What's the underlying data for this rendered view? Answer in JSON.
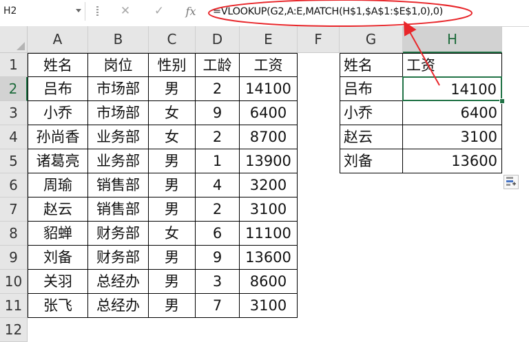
{
  "formula_bar": {
    "name_box": "H2",
    "cancel_icon": "✕",
    "enter_icon": "✓",
    "fx_label": "fx",
    "formula": "=VLOOKUP(G2,A:E,MATCH(H$1,$A$1:$E$1,0),0)"
  },
  "columns": [
    "A",
    "B",
    "C",
    "D",
    "E",
    "F",
    "G",
    "H"
  ],
  "selected_column": "H",
  "selected_row": "2",
  "active_cell": "H2",
  "rows": [
    "1",
    "2",
    "3",
    "4",
    "5",
    "6",
    "7",
    "8",
    "9",
    "10",
    "11",
    "12"
  ],
  "data_table": {
    "headers": [
      "姓名",
      "岗位",
      "性别",
      "工龄",
      "工资"
    ],
    "rows": [
      [
        "吕布",
        "市场部",
        "男",
        "2",
        "14100"
      ],
      [
        "小乔",
        "市场部",
        "女",
        "9",
        "6400"
      ],
      [
        "孙尚香",
        "业务部",
        "女",
        "2",
        "8700"
      ],
      [
        "诸葛亮",
        "业务部",
        "男",
        "1",
        "13900"
      ],
      [
        "周瑜",
        "销售部",
        "男",
        "4",
        "3200"
      ],
      [
        "赵云",
        "销售部",
        "男",
        "2",
        "3100"
      ],
      [
        "貂蝉",
        "财务部",
        "女",
        "6",
        "11100"
      ],
      [
        "刘备",
        "财务部",
        "男",
        "9",
        "13600"
      ],
      [
        "关羽",
        "总经办",
        "男",
        "3",
        "8600"
      ],
      [
        "张飞",
        "总经办",
        "男",
        "7",
        "3100"
      ]
    ]
  },
  "lookup_table": {
    "headers": [
      "姓名",
      "工资"
    ],
    "rows": [
      [
        "吕布",
        "14100"
      ],
      [
        "小乔",
        "6400"
      ],
      [
        "赵云",
        "3100"
      ],
      [
        "刘备",
        "13600"
      ]
    ]
  },
  "colors": {
    "accent": "#217346",
    "annotation": "#e8262a",
    "grid": "#000000"
  },
  "icons": {
    "name_box_dropdown": "chevron-down-icon",
    "paste_options": "paste-options-icon"
  }
}
